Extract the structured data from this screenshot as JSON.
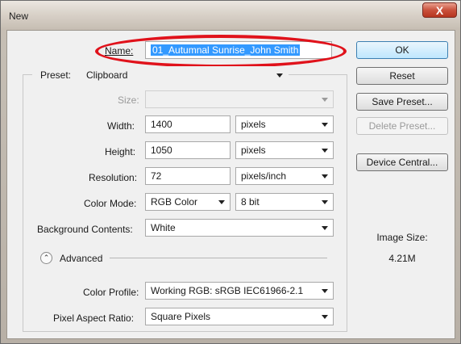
{
  "window": {
    "title": "New",
    "close_glyph": "X"
  },
  "form": {
    "name_label": "Name:",
    "name_value": "01_Autumnal Sunrise_John Smith",
    "preset_label": "Preset:",
    "preset_value": "Clipboard",
    "size_label": "Size:",
    "size_value": "",
    "width_label": "Width:",
    "width_value": "1400",
    "width_unit": "pixels",
    "height_label": "Height:",
    "height_value": "1050",
    "height_unit": "pixels",
    "resolution_label": "Resolution:",
    "resolution_value": "72",
    "resolution_unit": "pixels/inch",
    "color_mode_label": "Color Mode:",
    "color_mode_value": "RGB Color",
    "bit_depth_value": "8 bit",
    "background_label": "Background Contents:",
    "background_value": "White",
    "advanced_label": "Advanced",
    "color_profile_label": "Color Profile:",
    "color_profile_value": "Working RGB:  sRGB IEC61966-2.1",
    "pixel_aspect_label": "Pixel Aspect Ratio:",
    "pixel_aspect_value": "Square Pixels"
  },
  "buttons": {
    "ok": "OK",
    "reset": "Reset",
    "save_preset": "Save Preset...",
    "delete_preset": "Delete Preset...",
    "device_central": "Device Central..."
  },
  "info": {
    "image_size_label": "Image Size:",
    "image_size_value": "4.21M"
  },
  "colors": {
    "annotation_ellipse": "#e0121b",
    "selection": "#3399ff",
    "close_button": "#c9513c"
  }
}
